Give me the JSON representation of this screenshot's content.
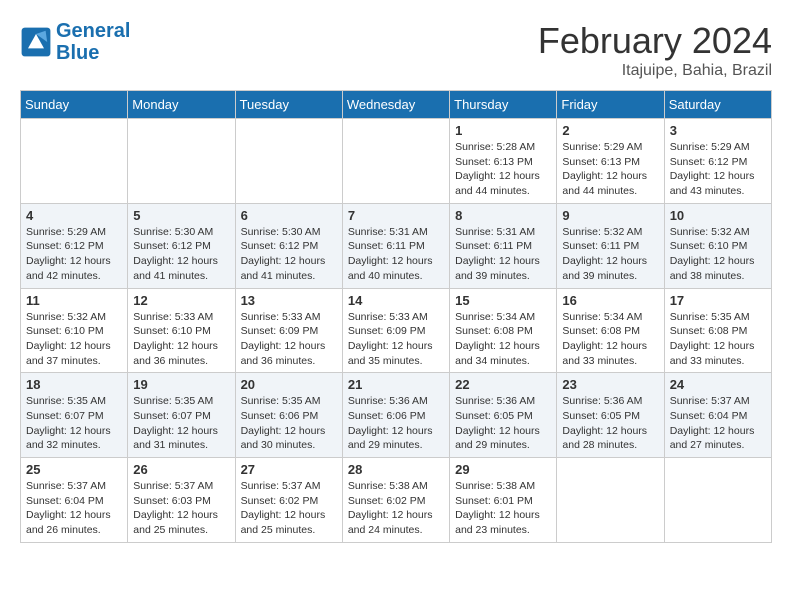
{
  "header": {
    "logo_line1": "General",
    "logo_line2": "Blue",
    "month_year": "February 2024",
    "location": "Itajuipe, Bahia, Brazil"
  },
  "days_of_week": [
    "Sunday",
    "Monday",
    "Tuesday",
    "Wednesday",
    "Thursday",
    "Friday",
    "Saturday"
  ],
  "weeks": [
    [
      {
        "day": "",
        "info": ""
      },
      {
        "day": "",
        "info": ""
      },
      {
        "day": "",
        "info": ""
      },
      {
        "day": "",
        "info": ""
      },
      {
        "day": "1",
        "info": "Sunrise: 5:28 AM\nSunset: 6:13 PM\nDaylight: 12 hours\nand 44 minutes."
      },
      {
        "day": "2",
        "info": "Sunrise: 5:29 AM\nSunset: 6:13 PM\nDaylight: 12 hours\nand 44 minutes."
      },
      {
        "day": "3",
        "info": "Sunrise: 5:29 AM\nSunset: 6:12 PM\nDaylight: 12 hours\nand 43 minutes."
      }
    ],
    [
      {
        "day": "4",
        "info": "Sunrise: 5:29 AM\nSunset: 6:12 PM\nDaylight: 12 hours\nand 42 minutes."
      },
      {
        "day": "5",
        "info": "Sunrise: 5:30 AM\nSunset: 6:12 PM\nDaylight: 12 hours\nand 41 minutes."
      },
      {
        "day": "6",
        "info": "Sunrise: 5:30 AM\nSunset: 6:12 PM\nDaylight: 12 hours\nand 41 minutes."
      },
      {
        "day": "7",
        "info": "Sunrise: 5:31 AM\nSunset: 6:11 PM\nDaylight: 12 hours\nand 40 minutes."
      },
      {
        "day": "8",
        "info": "Sunrise: 5:31 AM\nSunset: 6:11 PM\nDaylight: 12 hours\nand 39 minutes."
      },
      {
        "day": "9",
        "info": "Sunrise: 5:32 AM\nSunset: 6:11 PM\nDaylight: 12 hours\nand 39 minutes."
      },
      {
        "day": "10",
        "info": "Sunrise: 5:32 AM\nSunset: 6:10 PM\nDaylight: 12 hours\nand 38 minutes."
      }
    ],
    [
      {
        "day": "11",
        "info": "Sunrise: 5:32 AM\nSunset: 6:10 PM\nDaylight: 12 hours\nand 37 minutes."
      },
      {
        "day": "12",
        "info": "Sunrise: 5:33 AM\nSunset: 6:10 PM\nDaylight: 12 hours\nand 36 minutes."
      },
      {
        "day": "13",
        "info": "Sunrise: 5:33 AM\nSunset: 6:09 PM\nDaylight: 12 hours\nand 36 minutes."
      },
      {
        "day": "14",
        "info": "Sunrise: 5:33 AM\nSunset: 6:09 PM\nDaylight: 12 hours\nand 35 minutes."
      },
      {
        "day": "15",
        "info": "Sunrise: 5:34 AM\nSunset: 6:08 PM\nDaylight: 12 hours\nand 34 minutes."
      },
      {
        "day": "16",
        "info": "Sunrise: 5:34 AM\nSunset: 6:08 PM\nDaylight: 12 hours\nand 33 minutes."
      },
      {
        "day": "17",
        "info": "Sunrise: 5:35 AM\nSunset: 6:08 PM\nDaylight: 12 hours\nand 33 minutes."
      }
    ],
    [
      {
        "day": "18",
        "info": "Sunrise: 5:35 AM\nSunset: 6:07 PM\nDaylight: 12 hours\nand 32 minutes."
      },
      {
        "day": "19",
        "info": "Sunrise: 5:35 AM\nSunset: 6:07 PM\nDaylight: 12 hours\nand 31 minutes."
      },
      {
        "day": "20",
        "info": "Sunrise: 5:35 AM\nSunset: 6:06 PM\nDaylight: 12 hours\nand 30 minutes."
      },
      {
        "day": "21",
        "info": "Sunrise: 5:36 AM\nSunset: 6:06 PM\nDaylight: 12 hours\nand 29 minutes."
      },
      {
        "day": "22",
        "info": "Sunrise: 5:36 AM\nSunset: 6:05 PM\nDaylight: 12 hours\nand 29 minutes."
      },
      {
        "day": "23",
        "info": "Sunrise: 5:36 AM\nSunset: 6:05 PM\nDaylight: 12 hours\nand 28 minutes."
      },
      {
        "day": "24",
        "info": "Sunrise: 5:37 AM\nSunset: 6:04 PM\nDaylight: 12 hours\nand 27 minutes."
      }
    ],
    [
      {
        "day": "25",
        "info": "Sunrise: 5:37 AM\nSunset: 6:04 PM\nDaylight: 12 hours\nand 26 minutes."
      },
      {
        "day": "26",
        "info": "Sunrise: 5:37 AM\nSunset: 6:03 PM\nDaylight: 12 hours\nand 25 minutes."
      },
      {
        "day": "27",
        "info": "Sunrise: 5:37 AM\nSunset: 6:02 PM\nDaylight: 12 hours\nand 25 minutes."
      },
      {
        "day": "28",
        "info": "Sunrise: 5:38 AM\nSunset: 6:02 PM\nDaylight: 12 hours\nand 24 minutes."
      },
      {
        "day": "29",
        "info": "Sunrise: 5:38 AM\nSunset: 6:01 PM\nDaylight: 12 hours\nand 23 minutes."
      },
      {
        "day": "",
        "info": ""
      },
      {
        "day": "",
        "info": ""
      }
    ]
  ]
}
